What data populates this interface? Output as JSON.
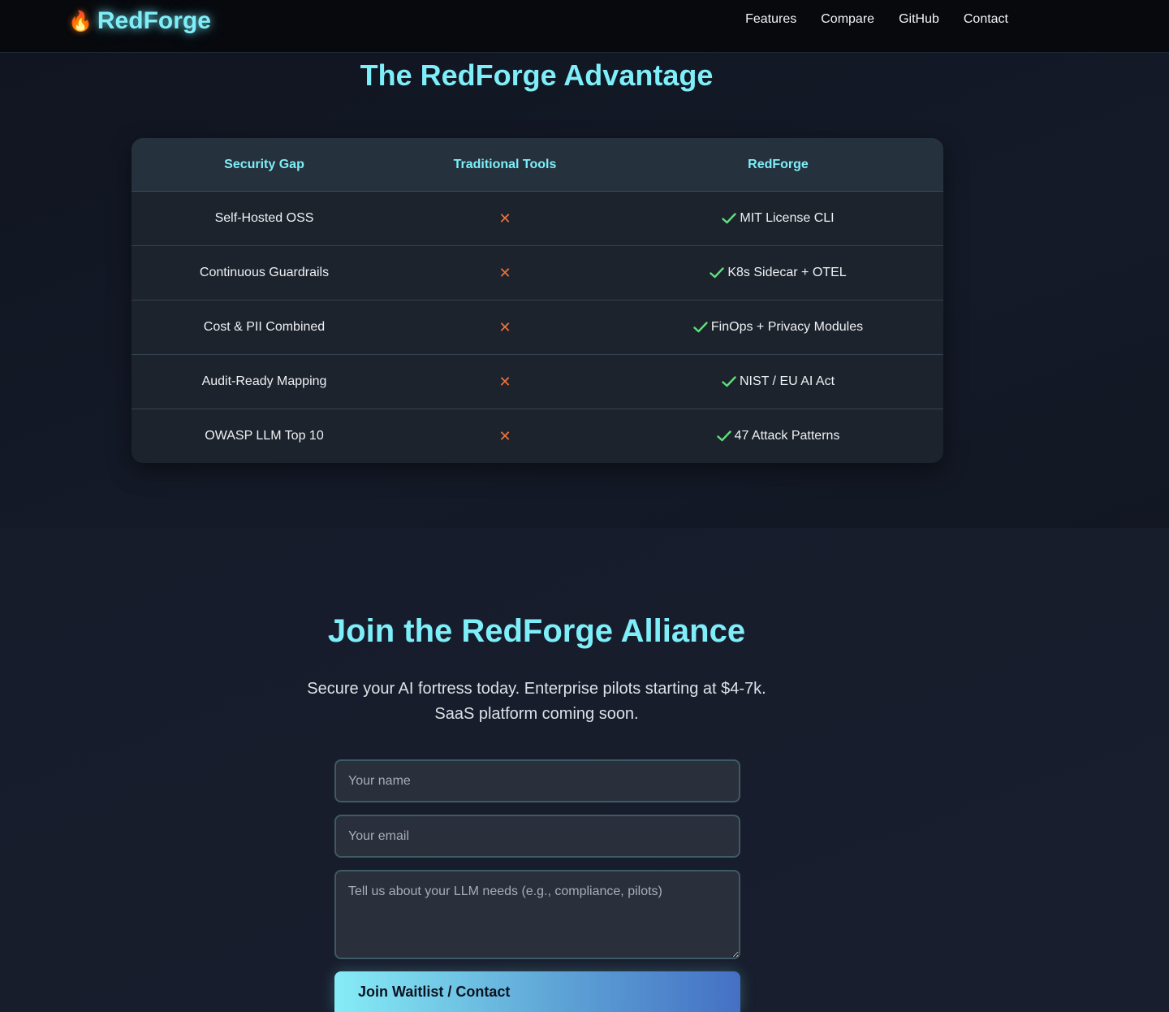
{
  "nav": {
    "logo_text": "RedForge",
    "logo_icon": "flame-icon",
    "links": [
      "Features",
      "Compare",
      "GitHub",
      "Contact"
    ]
  },
  "compare": {
    "title": "The RedForge Advantage",
    "headers": [
      "Security Gap",
      "Traditional Tools",
      "RedForge"
    ],
    "rows": [
      {
        "gap": "Self-Hosted OSS",
        "traditional": "✕",
        "redforge": "MIT License CLI"
      },
      {
        "gap": "Continuous Guardrails",
        "traditional": "✕",
        "redforge": "K8s Sidecar + OTEL"
      },
      {
        "gap": "Cost & PII Combined",
        "traditional": "✕",
        "redforge": "FinOps + Privacy Modules"
      },
      {
        "gap": "Audit-Ready Mapping",
        "traditional": "✕",
        "redforge": "NIST / EU AI Act"
      },
      {
        "gap": "OWASP LLM Top 10",
        "traditional": "✕",
        "redforge": "47 Attack Patterns"
      }
    ]
  },
  "alliance": {
    "title": "Join the RedForge Alliance",
    "subtitle": "Secure your AI fortress today. Enterprise pilots starting at $4-7k. SaaS platform coming soon.",
    "name_placeholder": "Your name",
    "email_placeholder": "Your email",
    "needs_placeholder": "Tell us about your LLM needs (e.g., compliance, pilots)",
    "submit_label": "Join Waitlist / Contact"
  },
  "colors": {
    "accent": "#7eeef8",
    "cross": "#f0733a",
    "check": "#5ee07a",
    "background": "#121826"
  }
}
